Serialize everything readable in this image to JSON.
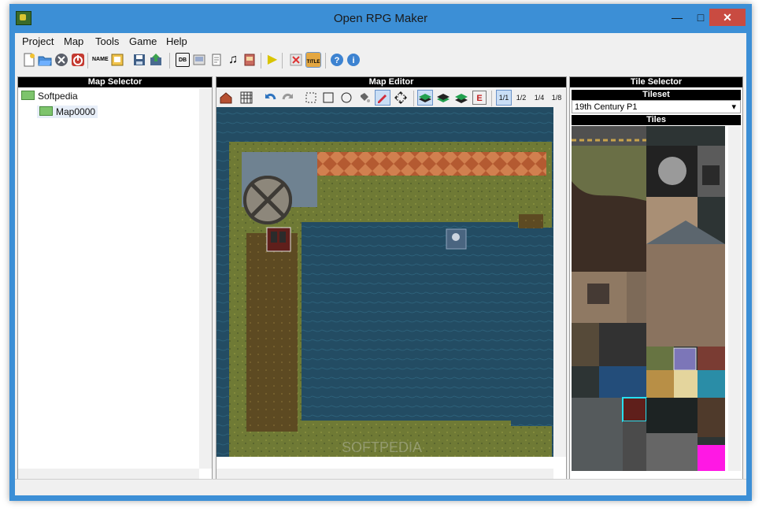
{
  "window": {
    "title": "Open RPG Maker",
    "minimize": "—",
    "maximize": "□",
    "close": "✕"
  },
  "menu": {
    "items": [
      "Project",
      "Map",
      "Tools",
      "Game",
      "Help"
    ]
  },
  "toolbar": {
    "name_label": "NAME",
    "db_label": "DB",
    "title_label": "TITLE",
    "music_icon": "♫",
    "play_icon": "▶"
  },
  "map_selector": {
    "header": "Map Selector",
    "root": "Softpedia",
    "child": "Map0000"
  },
  "map_editor": {
    "header": "Map Editor",
    "layer_label": "E",
    "zoom": [
      "1/1",
      "1/2",
      "1/4",
      "1/8"
    ]
  },
  "tile_selector": {
    "header": "Tile Selector",
    "tileset_label": "Tileset",
    "tileset_value": "19th Century P1",
    "tiles_label": "Tiles"
  },
  "colors": {
    "chrome": "#3c8fd6",
    "water": "#234c63",
    "grass": "#6f7a35",
    "dirt": "#5d4a22",
    "lava": "#c56a3b",
    "selection": "#6a93c9"
  }
}
